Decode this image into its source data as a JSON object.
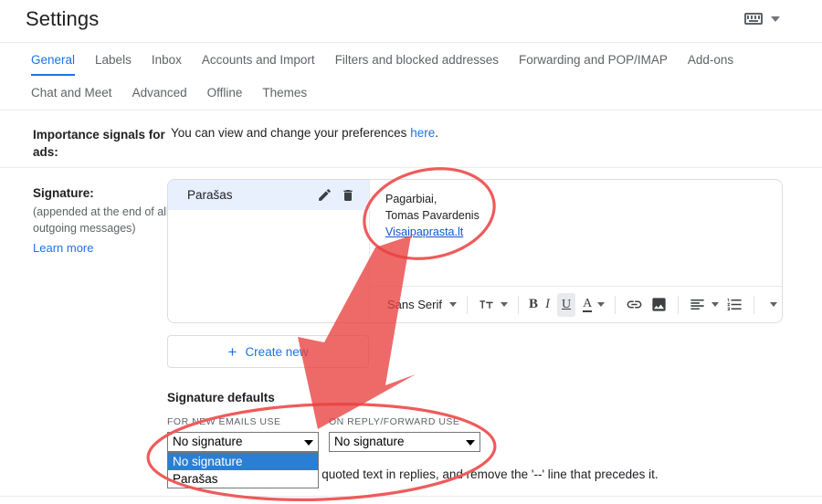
{
  "header": {
    "title": "Settings",
    "keyboard_icon": "keyboard-icon",
    "caret_icon": "chevron-down-icon"
  },
  "tabs_row1": [
    {
      "label": "General",
      "active": true
    },
    {
      "label": "Labels",
      "active": false
    },
    {
      "label": "Inbox",
      "active": false
    },
    {
      "label": "Accounts and Import",
      "active": false
    },
    {
      "label": "Filters and blocked addresses",
      "active": false
    },
    {
      "label": "Forwarding and POP/IMAP",
      "active": false
    },
    {
      "label": "Add-ons",
      "active": false
    }
  ],
  "tabs_row2": [
    {
      "label": "Chat and Meet",
      "active": false
    },
    {
      "label": "Advanced",
      "active": false
    },
    {
      "label": "Offline",
      "active": false
    },
    {
      "label": "Themes",
      "active": false
    }
  ],
  "importance": {
    "label": "Importance signals for ads:",
    "text_before": "You can view and change your preferences ",
    "link": "here",
    "text_after": "."
  },
  "signature": {
    "label_title": "Signature:",
    "label_note": "(appended at the end of all outgoing messages)",
    "learn_more": "Learn more",
    "items": [
      {
        "name": "Parašas",
        "selected": true
      }
    ],
    "edit_icon": "pencil-icon",
    "delete_icon": "trash-icon",
    "body_lines": [
      "Pagarbiai,",
      "Tomas Pavardenis"
    ],
    "body_link": "Visaipaprasta.lt",
    "create_new": "Create new",
    "create_new_icon": "plus-icon"
  },
  "toolbar": {
    "font_name": "Sans Serif",
    "items": [
      {
        "name": "font-family-selector",
        "label": "Sans Serif"
      },
      {
        "name": "font-size-selector",
        "label": "ŦT"
      },
      {
        "name": "bold-button",
        "label": "B"
      },
      {
        "name": "italic-button",
        "label": "I"
      },
      {
        "name": "underline-button",
        "label": "U",
        "active": true
      },
      {
        "name": "text-color-button",
        "label": "A"
      },
      {
        "name": "insert-link-button",
        "label": "link-icon"
      },
      {
        "name": "insert-image-button",
        "label": "image-icon"
      },
      {
        "name": "align-button",
        "label": "align-left-icon"
      },
      {
        "name": "list-button",
        "label": "numbered-list-icon"
      },
      {
        "name": "more-options-button",
        "label": "chevron-down-icon"
      }
    ]
  },
  "signature_defaults": {
    "title": "Signature defaults",
    "new_emails_caption": "FOR NEW EMAILS USE",
    "reply_caption": "ON REPLY/FORWARD USE",
    "new_emails_value": "No signature",
    "reply_value": "No signature",
    "options": [
      {
        "label": "No signature",
        "selected": true
      },
      {
        "label": "Parašas",
        "selected": false
      }
    ]
  },
  "footer_note": "e quoted text in replies, and remove the '--' line that precedes it.",
  "annotations": {
    "color": "#ef5b5b",
    "ellipse_top": "highlight-ellipse-signature-body",
    "ellipse_bottom": "highlight-ellipse-signature-defaults",
    "arrow": "pointer-arrow"
  },
  "colors": {
    "accent": "#1a73e8",
    "selected_row": "#e8f0fe",
    "annotation_red": "#ef5b5b",
    "text": "#202124",
    "muted": "#5f6368"
  }
}
